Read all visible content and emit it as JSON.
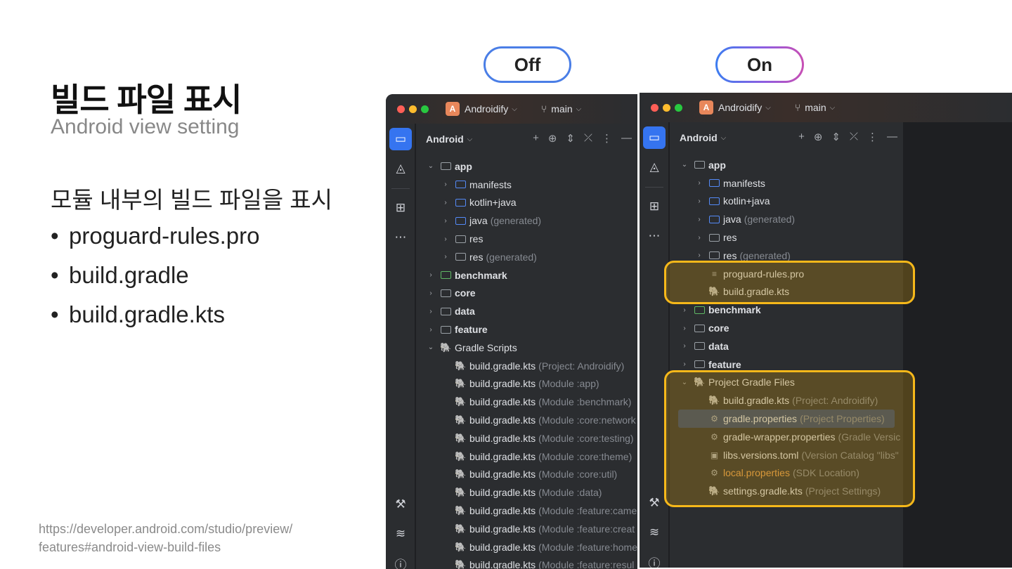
{
  "slide": {
    "title": "빌드 파일 표시",
    "subtitle": "Android view setting",
    "heading": "모듈 내부의 빌드 파일을 표시",
    "bullets": [
      "proguard-rules.pro",
      "build.gradle",
      "build.gradle.kts"
    ],
    "bullet_symbol": "•",
    "source_line1": "https://developer.android.com/studio/preview/",
    "source_line2": "features#android-view-build-files"
  },
  "toggles": {
    "off_label": "Off",
    "on_label": "On"
  },
  "ide": {
    "project_badge": "A",
    "project_name": "Androidify",
    "branch": "main",
    "view_mode": "Android",
    "chevron": "⌵",
    "colors": {
      "accent": "#3574f0",
      "highlight": "#f6b81a",
      "selected_row": "#2e436e",
      "orange_text": "#e69e4d"
    }
  },
  "left_tree": [
    {
      "indent": 0,
      "arrow": "⌄",
      "icon": "folder",
      "name": "app",
      "hint": "",
      "bold": true
    },
    {
      "indent": 1,
      "arrow": "›",
      "icon": "folder-blue",
      "name": "manifests",
      "hint": ""
    },
    {
      "indent": 1,
      "arrow": "›",
      "icon": "folder-blue",
      "name": "kotlin+java",
      "hint": ""
    },
    {
      "indent": 1,
      "arrow": "›",
      "icon": "folder-blue",
      "name": "java",
      "hint": "(generated)"
    },
    {
      "indent": 1,
      "arrow": "›",
      "icon": "folder-res",
      "name": "res",
      "hint": ""
    },
    {
      "indent": 1,
      "arrow": "›",
      "icon": "folder-res",
      "name": "res",
      "hint": "(generated)"
    },
    {
      "indent": 0,
      "arrow": "›",
      "icon": "folder-green",
      "name": "benchmark",
      "hint": "",
      "bold": true
    },
    {
      "indent": 0,
      "arrow": "›",
      "icon": "folder",
      "name": "core",
      "hint": "",
      "bold": true
    },
    {
      "indent": 0,
      "arrow": "›",
      "icon": "folder",
      "name": "data",
      "hint": "",
      "bold": true
    },
    {
      "indent": 0,
      "arrow": "›",
      "icon": "folder",
      "name": "feature",
      "hint": "",
      "bold": true
    },
    {
      "indent": 0,
      "arrow": "⌄",
      "icon": "gradle",
      "name": "Gradle Scripts",
      "hint": ""
    },
    {
      "indent": 1,
      "arrow": "",
      "icon": "gradle",
      "name": "build.gradle.kts",
      "hint": "(Project: Androidify)"
    },
    {
      "indent": 1,
      "arrow": "",
      "icon": "gradle",
      "name": "build.gradle.kts",
      "hint": "(Module :app)"
    },
    {
      "indent": 1,
      "arrow": "",
      "icon": "gradle",
      "name": "build.gradle.kts",
      "hint": "(Module :benchmark)"
    },
    {
      "indent": 1,
      "arrow": "",
      "icon": "gradle",
      "name": "build.gradle.kts",
      "hint": "(Module :core:network"
    },
    {
      "indent": 1,
      "arrow": "",
      "icon": "gradle",
      "name": "build.gradle.kts",
      "hint": "(Module :core:testing)"
    },
    {
      "indent": 1,
      "arrow": "",
      "icon": "gradle",
      "name": "build.gradle.kts",
      "hint": "(Module :core:theme)"
    },
    {
      "indent": 1,
      "arrow": "",
      "icon": "gradle",
      "name": "build.gradle.kts",
      "hint": "(Module :core:util)"
    },
    {
      "indent": 1,
      "arrow": "",
      "icon": "gradle",
      "name": "build.gradle.kts",
      "hint": "(Module :data)"
    },
    {
      "indent": 1,
      "arrow": "",
      "icon": "gradle",
      "name": "build.gradle.kts",
      "hint": "(Module :feature:came"
    },
    {
      "indent": 1,
      "arrow": "",
      "icon": "gradle",
      "name": "build.gradle.kts",
      "hint": "(Module :feature:creat"
    },
    {
      "indent": 1,
      "arrow": "",
      "icon": "gradle",
      "name": "build.gradle.kts",
      "hint": "(Module :feature:home"
    },
    {
      "indent": 1,
      "arrow": "",
      "icon": "gradle",
      "name": "build.gradle.kts",
      "hint": "(Module :feature:resul"
    }
  ],
  "right_tree": [
    {
      "indent": 0,
      "arrow": "⌄",
      "icon": "folder",
      "name": "app",
      "hint": "",
      "bold": true
    },
    {
      "indent": 1,
      "arrow": "›",
      "icon": "folder-blue",
      "name": "manifests",
      "hint": ""
    },
    {
      "indent": 1,
      "arrow": "›",
      "icon": "folder-blue",
      "name": "kotlin+java",
      "hint": ""
    },
    {
      "indent": 1,
      "arrow": "›",
      "icon": "folder-blue",
      "name": "java",
      "hint": "(generated)"
    },
    {
      "indent": 1,
      "arrow": "›",
      "icon": "folder-res",
      "name": "res",
      "hint": ""
    },
    {
      "indent": 1,
      "arrow": "›",
      "icon": "folder-res",
      "name": "res",
      "hint": "(generated)"
    },
    {
      "indent": 1,
      "arrow": "",
      "icon": "text-file",
      "name": "proguard-rules.pro",
      "hint": ""
    },
    {
      "indent": 1,
      "arrow": "",
      "icon": "gradle",
      "name": "build.gradle.kts",
      "hint": ""
    },
    {
      "indent": 0,
      "arrow": "›",
      "icon": "folder-green",
      "name": "benchmark",
      "hint": "",
      "bold": true
    },
    {
      "indent": 0,
      "arrow": "›",
      "icon": "folder",
      "name": "core",
      "hint": "",
      "bold": true
    },
    {
      "indent": 0,
      "arrow": "›",
      "icon": "folder",
      "name": "data",
      "hint": "",
      "bold": true
    },
    {
      "indent": 0,
      "arrow": "›",
      "icon": "folder",
      "name": "feature",
      "hint": "",
      "bold": true
    },
    {
      "indent": 0,
      "arrow": "⌄",
      "icon": "gradle",
      "name": "Project Gradle Files",
      "hint": ""
    },
    {
      "indent": 1,
      "arrow": "",
      "icon": "gradle",
      "name": "build.gradle.kts",
      "hint": "(Project: Androidify)"
    },
    {
      "indent": 1,
      "arrow": "",
      "icon": "gear",
      "name": "gradle.properties",
      "hint": "(Project Properties)",
      "selected": true
    },
    {
      "indent": 1,
      "arrow": "",
      "icon": "gear",
      "name": "gradle-wrapper.properties",
      "hint": "(Gradle Versic"
    },
    {
      "indent": 1,
      "arrow": "",
      "icon": "toml",
      "name": "libs.versions.toml",
      "hint": "(Version Catalog \"libs\""
    },
    {
      "indent": 1,
      "arrow": "",
      "icon": "gear",
      "name": "local.properties",
      "hint": "(SDK Location)",
      "orange": true
    },
    {
      "indent": 1,
      "arrow": "",
      "icon": "gradle",
      "name": "settings.gradle.kts",
      "hint": "(Project Settings)"
    }
  ]
}
